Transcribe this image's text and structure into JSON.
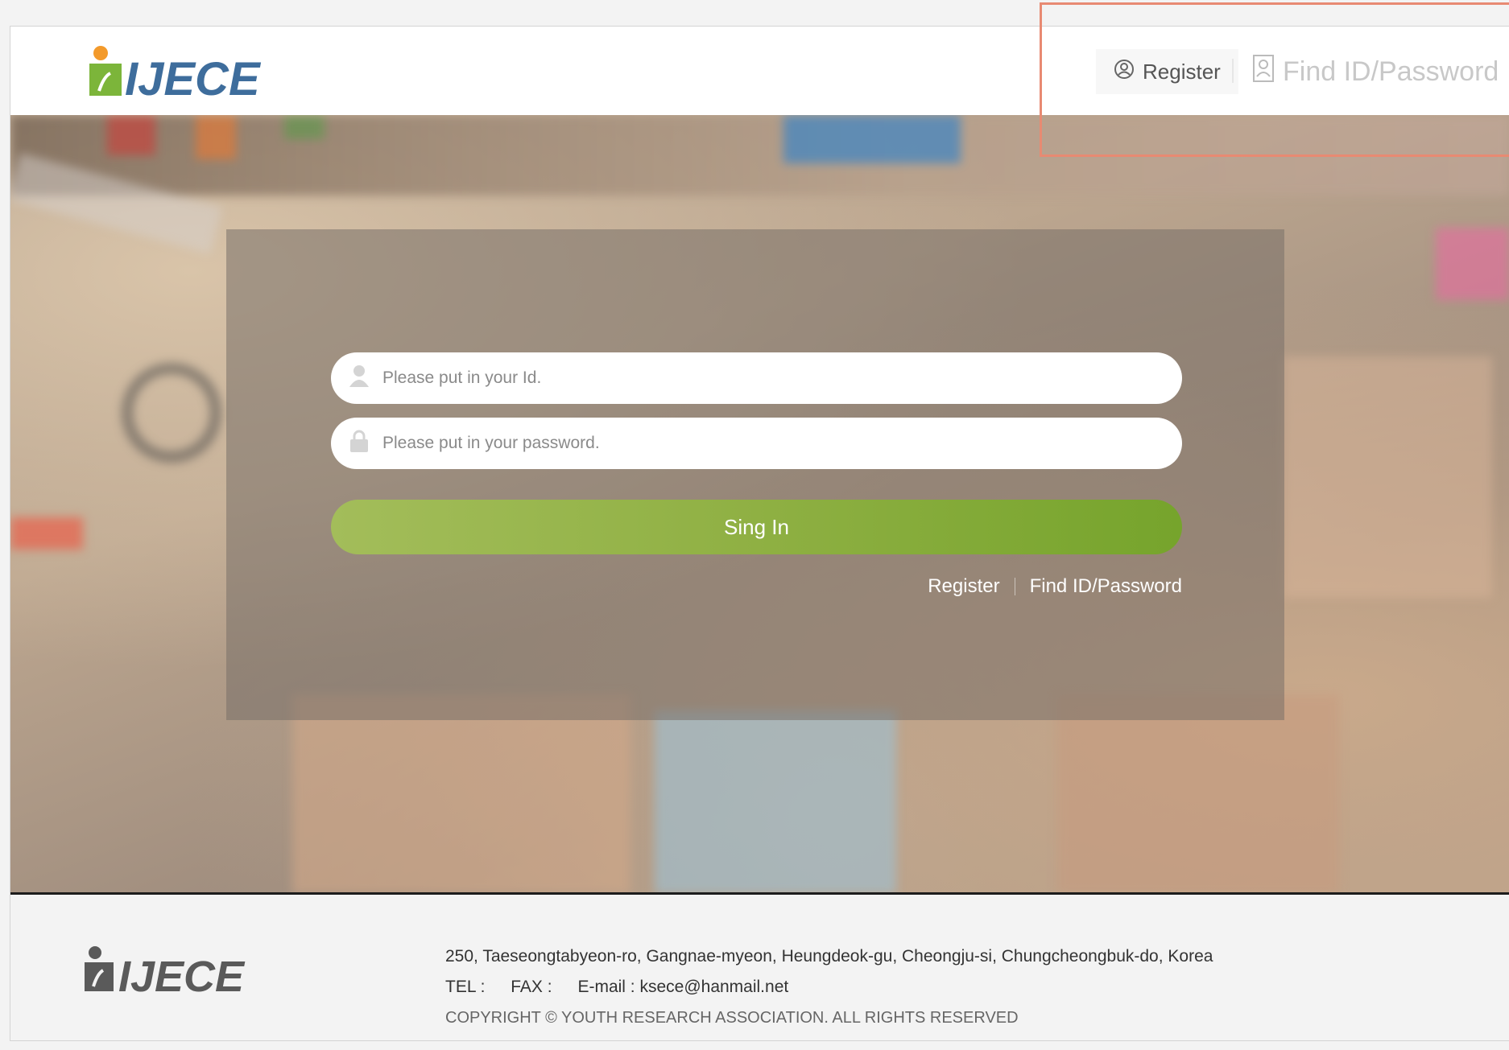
{
  "header": {
    "logo_text": "IJECE",
    "register_label": "Register",
    "find_label": "Find ID/Password"
  },
  "login": {
    "id_placeholder": "Please put in your Id.",
    "password_placeholder": "Please put in your password.",
    "signin_label": "Sing In",
    "register_link": "Register",
    "find_link": "Find ID/Password"
  },
  "footer": {
    "logo_text": "IJECE",
    "address": "250, Taeseongtabyeon-ro, Gangnae-myeon, Heungdeok-gu, Cheongju-si, Chungcheongbuk-do, Korea",
    "tel_label": "TEL :",
    "fax_label": "FAX :",
    "email": "E-mail : ksece@hanmail.net",
    "copyright": "COPYRIGHT © YOUTH RESEARCH ASSOCIATION. ALL RIGHTS RESERVED"
  },
  "colors": {
    "brand_blue": "#3e6d9c",
    "brand_green": "#7cb53a",
    "brand_orange": "#f39a2b",
    "signin_green": "#8fb043",
    "highlight": "#e88a72"
  },
  "icons": {
    "register": "user-circle-icon",
    "find": "id-card-icon",
    "id_field": "user-icon",
    "password_field": "lock-icon"
  }
}
